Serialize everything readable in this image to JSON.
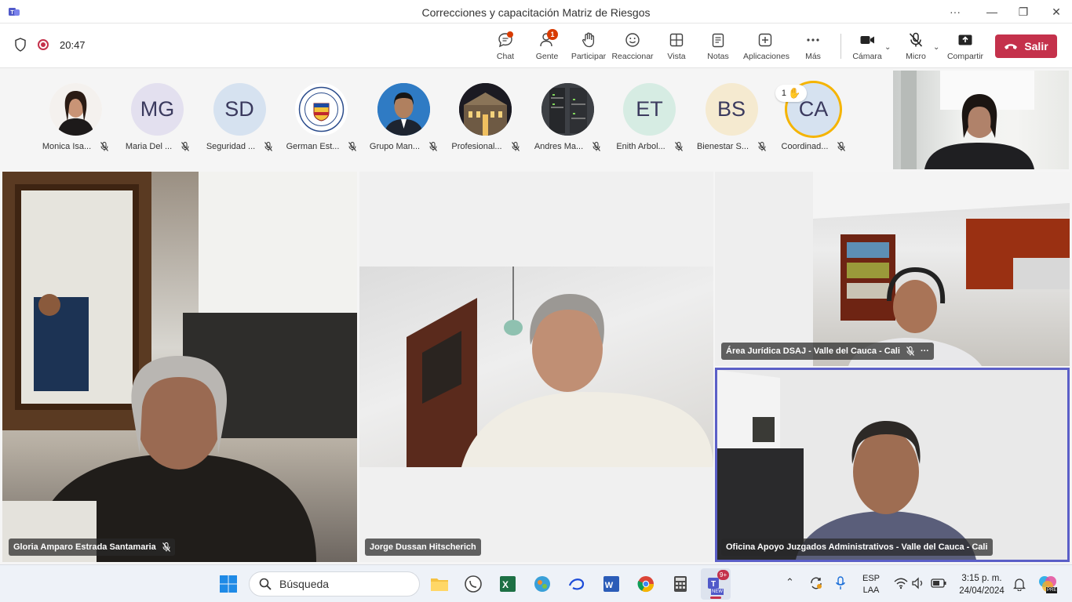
{
  "window": {
    "title": "Correcciones y capacitación Matriz de Riesgos",
    "more": "···",
    "minimize": "—",
    "restore": "❐",
    "close": "✕"
  },
  "toolbar": {
    "timer": "20:47",
    "buttons": [
      {
        "label": "Chat",
        "icon": "chat-icon"
      },
      {
        "label": "Gente",
        "icon": "people-icon",
        "badge": "1"
      },
      {
        "label": "Participar",
        "icon": "raise-hand-icon"
      },
      {
        "label": "Reaccionar",
        "icon": "smiley-icon"
      },
      {
        "label": "Vista",
        "icon": "grid-view-icon"
      },
      {
        "label": "Notas",
        "icon": "notes-icon"
      },
      {
        "label": "Aplicaciones",
        "icon": "add-app-icon"
      },
      {
        "label": "Más",
        "icon": "more-icon"
      },
      {
        "label": "Cámara",
        "icon": "camera-icon"
      },
      {
        "label": "Micro",
        "icon": "mic-off-icon"
      },
      {
        "label": "Compartir",
        "icon": "share-icon"
      }
    ],
    "leave_label": "Salir",
    "leave_color": "#c4314b"
  },
  "participants": [
    {
      "name": "Monica Isa...",
      "initials": "",
      "kind": "photo-woman",
      "color": "#ffffff"
    },
    {
      "name": "Maria Del ...",
      "initials": "MG",
      "kind": "initials",
      "color": "#e3e0ef"
    },
    {
      "name": "Seguridad ...",
      "initials": "SD",
      "kind": "initials",
      "color": "#d6e2f0"
    },
    {
      "name": "German Est...",
      "initials": "",
      "kind": "seal",
      "color": "#ffffff"
    },
    {
      "name": "Grupo Man...",
      "initials": "",
      "kind": "photo-man",
      "color": "#2f7bc4"
    },
    {
      "name": "Profesional...",
      "initials": "",
      "kind": "photo-building",
      "color": "#2b2a30"
    },
    {
      "name": "Andres Ma...",
      "initials": "",
      "kind": "photo-server",
      "color": "#4a4d52"
    },
    {
      "name": "Enith Arbol...",
      "initials": "ET",
      "kind": "initials",
      "color": "#d6ece3"
    },
    {
      "name": "Bienestar S...",
      "initials": "BS",
      "kind": "initials",
      "color": "#f5ead0"
    },
    {
      "name": "Coordinad...",
      "initials": "CA",
      "kind": "initials",
      "color": "#d6e2f0"
    }
  ],
  "raised_hand": {
    "count": "1"
  },
  "tiles": {
    "gloria": "Gloria Amparo Estrada Santamaria",
    "jorge": "Jorge Dussan Hitscherich",
    "area": "Área Jurídica DSAJ - Valle del Cauca - Cali",
    "area_more": "···",
    "oficina": "Oficina Apoyo Juzgados Administrativos - Valle del Cauca - Cali"
  },
  "taskbar": {
    "search_placeholder": "Búsqueda",
    "teams_badge": "9+",
    "teams_new": "NEW",
    "lang": "ESP",
    "layout": "LAA",
    "time": "3:15 p. m.",
    "date": "24/04/2024",
    "copilot_label": "PRE"
  },
  "colors": {
    "accent": "#5b5fc7",
    "leave": "#c4314b",
    "badge": "#d83b01"
  }
}
